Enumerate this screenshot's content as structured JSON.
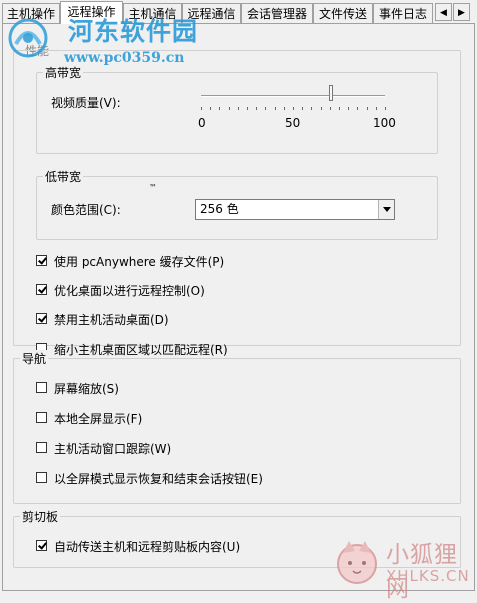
{
  "tabs": [
    {
      "label": "主机操作",
      "active": false
    },
    {
      "label": "远程操作",
      "active": true
    },
    {
      "label": "主机通信",
      "active": false
    },
    {
      "label": "远程通信",
      "active": false
    },
    {
      "label": "会话管理器",
      "active": false
    },
    {
      "label": "文件传送",
      "active": false
    },
    {
      "label": "事件日志",
      "active": false
    }
  ],
  "tab_scroll": {
    "left_icon": "chevron-left-icon",
    "right_icon": "chevron-right-icon"
  },
  "ghost_label": "性能",
  "high_bandwidth": {
    "title": "高带宽",
    "video_quality_label": "视频质量(V):",
    "slider": {
      "min": 0,
      "max": 100,
      "value": 72,
      "ticks": [
        "0",
        "50",
        "100"
      ]
    }
  },
  "low_bandwidth": {
    "title": "低带宽",
    "tm_mark": "™",
    "color_range_label": "颜色范围(C):",
    "color_range_value": "256 色"
  },
  "performance_options": [
    {
      "label": "使用 pcAnywhere 缓存文件(P)",
      "checked": true
    },
    {
      "label": "优化桌面以进行远程控制(O)",
      "checked": true
    },
    {
      "label": "禁用主机活动桌面(D)",
      "checked": true
    },
    {
      "label": "缩小主机桌面区域以匹配远程(R)",
      "checked": false
    }
  ],
  "navigation": {
    "title": "导航",
    "options": [
      {
        "label": "屏幕缩放(S)",
        "checked": false
      },
      {
        "label": "本地全屏显示(F)",
        "checked": false
      },
      {
        "label": "主机活动窗口跟踪(W)",
        "checked": false
      },
      {
        "label": "以全屏模式显示恢复和结束会话按钮(E)",
        "checked": false
      }
    ]
  },
  "clipboard": {
    "title": "剪切板",
    "options": [
      {
        "label": "自动传送主机和远程剪贴板内容(U)",
        "checked": true
      }
    ]
  },
  "watermark_top": {
    "title": "河东软件园",
    "url": "www.pc0359.cn"
  },
  "watermark_bottom": {
    "title": "小狐狸网",
    "url": "XHLKS.CN"
  },
  "colors": {
    "accent": "#2b9bd8",
    "panel": "#f0f0f0",
    "border": "#a0a0a0"
  }
}
